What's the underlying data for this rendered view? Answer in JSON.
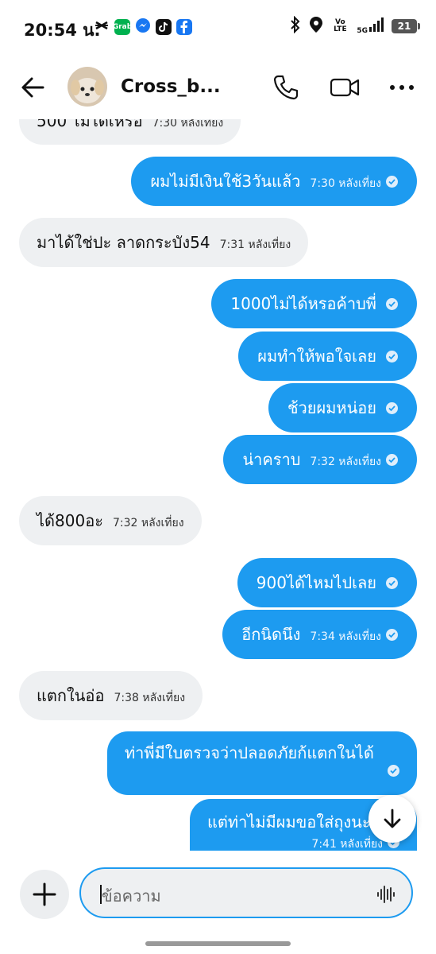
{
  "status_bar": {
    "time": "20:54 น.",
    "grab_label": "Grab",
    "volte": "Vo LTE",
    "network": "5G",
    "battery": "21"
  },
  "header": {
    "contact_name": "Cross_b..."
  },
  "messages": [
    {
      "direction": "incoming",
      "text": "500 ไม่ได้เหรอ",
      "time": "7:30 หลังเที่ยง"
    },
    {
      "direction": "outgoing",
      "text": "ผมไม่มีเงินใช้3วันแล้ว",
      "time": "7:30 หลังเที่ยง"
    },
    {
      "direction": "incoming",
      "text": "มาได้ใช่ปะ ลาดกระบัง54",
      "time": "7:31 หลังเที่ยง"
    },
    {
      "direction": "outgoing",
      "text": "1000ไม่ได้หรอค้าบพี่",
      "time": ""
    },
    {
      "direction": "outgoing",
      "text": "ผมทำให้พอใจเลย",
      "time": ""
    },
    {
      "direction": "outgoing",
      "text": "ช้วยผมหน่อย",
      "time": ""
    },
    {
      "direction": "outgoing",
      "text": "น่าคราบ",
      "time": "7:32 หลังเที่ยง"
    },
    {
      "direction": "incoming",
      "text": "ได้800อะ",
      "time": "7:32 หลังเที่ยง"
    },
    {
      "direction": "outgoing",
      "text": "900ได้ไหมไปเลย",
      "time": ""
    },
    {
      "direction": "outgoing",
      "text": "อีกนิดนึง",
      "time": "7:34 หลังเที่ยง"
    },
    {
      "direction": "incoming",
      "text": "แตกในอ่อ",
      "time": "7:38 หลังเที่ยง"
    },
    {
      "direction": "outgoing",
      "text": "ท่าพี่มีใบตรวจว่าปลอดภัยก้แตกในได้",
      "time": ""
    },
    {
      "direction": "outgoing",
      "text": "แต่ท่าไม่มีผมขอใส่ถุงนะ",
      "time": "7:41 หลังเที่ยง"
    }
  ],
  "composer": {
    "placeholder": "ข้อความ"
  },
  "colors": {
    "accent": "#1d9bf0",
    "incoming_bubble": "#eef0f2"
  }
}
